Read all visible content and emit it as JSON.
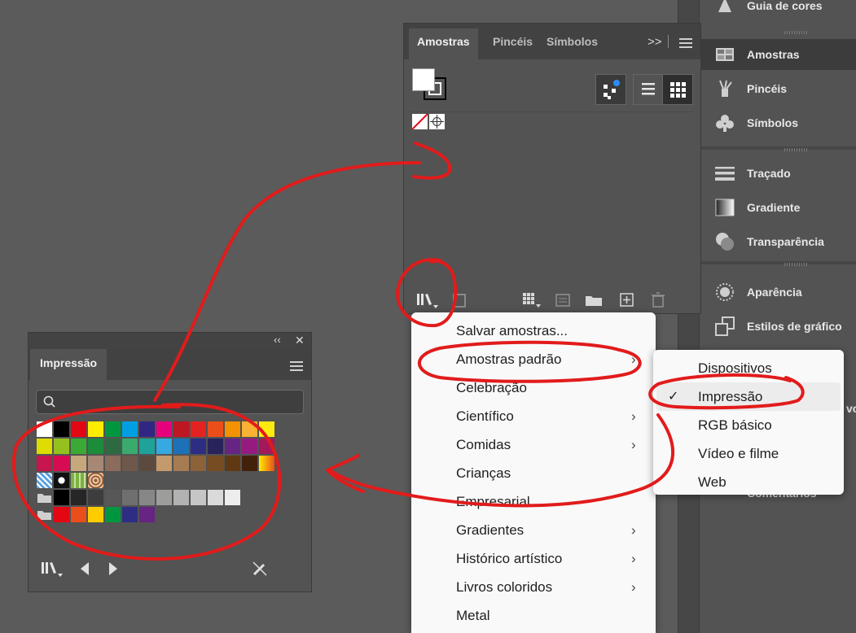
{
  "dock": {
    "top_partial": "Guia de cores",
    "items": [
      {
        "label": "Amostras",
        "icon": "swatches-icon",
        "active": true
      },
      {
        "label": "Pincéis",
        "icon": "brushes-icon"
      },
      {
        "label": "Símbolos",
        "icon": "symbols-icon"
      },
      {
        "label": "Traçado",
        "icon": "stroke-icon"
      },
      {
        "label": "Gradiente",
        "icon": "gradient-icon"
      },
      {
        "label": "Transparência",
        "icon": "transparency-icon"
      },
      {
        "label": "Aparência",
        "icon": "appearance-icon"
      },
      {
        "label": "Estilos de gráfico",
        "icon": "graphic-styles-icon"
      }
    ],
    "partial_hidden_1": "vo",
    "partial_hidden_2": "Comentários"
  },
  "swatches_panel": {
    "tabs": [
      "Amostras",
      "Pincéis",
      "Símbolos"
    ],
    "overflow_label": ">>",
    "fill_color": "#ffffff",
    "stroke_color": "#000000"
  },
  "menu": {
    "items": [
      {
        "label": "Salvar amostras...",
        "submenu": false
      },
      {
        "label": "Amostras padrão",
        "submenu": true
      },
      {
        "label": "Celebração",
        "submenu": false
      },
      {
        "label": "Científico",
        "submenu": true
      },
      {
        "label": "Comidas",
        "submenu": true
      },
      {
        "label": "Crianças",
        "submenu": false
      },
      {
        "label": "Empresarial",
        "submenu": false
      },
      {
        "label": "Gradientes",
        "submenu": true
      },
      {
        "label": "Histórico artístico",
        "submenu": true
      },
      {
        "label": "Livros coloridos",
        "submenu": true
      },
      {
        "label": "Metal",
        "submenu": false
      }
    ]
  },
  "submenu": {
    "items": [
      {
        "label": "Dispositivos",
        "checked": false
      },
      {
        "label": "Impressão",
        "checked": true
      },
      {
        "label": "RGB básico",
        "checked": false
      },
      {
        "label": "Vídeo e filme",
        "checked": false
      },
      {
        "label": "Web",
        "checked": false
      }
    ]
  },
  "library_panel": {
    "title": "Impressão",
    "collapse_label": "‹‹",
    "close_label": "✕",
    "search_placeholder": "",
    "rows": [
      [
        "#ffffff",
        "#000000",
        "#e30613",
        "#ffed00",
        "#009640",
        "#009fe3",
        "#312783",
        "#e6007e",
        "#be1622",
        "#e42320",
        "#e94e1b",
        "#f39200",
        "#f9b233",
        "#fcea10"
      ],
      [
        "#dedc00",
        "#95c11f",
        "#3aaa35",
        "#1d8c3a",
        "#2d6a3f",
        "#3aaa6d",
        "#1fa29a",
        "#36a9e1",
        "#1d71b8",
        "#2d2e83",
        "#29235c",
        "#662483",
        "#951b81",
        "#a3195b"
      ],
      [
        "#c6154f",
        "#d60b52",
        "#c7a77c",
        "#a68875",
        "#8b6c5c",
        "#6f574b",
        "#5c4a3f",
        "#c49a6c",
        "#a67c52",
        "#8c6239",
        "#754c24",
        "#603913",
        "#42210b",
        "#gradient"
      ],
      [
        "#pattern1",
        "#pattern2",
        "#pattern3",
        "#pattern4"
      ],
      [
        "#folder",
        "#000000",
        "#262626",
        "#3d3d3d",
        "#575756",
        "#706f6f",
        "#878787",
        "#9d9d9c",
        "#b2b2b2",
        "#c6c6c6",
        "#dadada",
        "#ededed"
      ],
      [
        "#folder",
        "#e30613",
        "#e94e1b",
        "#ffcc00",
        "#009640",
        "#2d2e83",
        "#662483"
      ]
    ]
  },
  "colors": {
    "annotation": "#e21b1b",
    "menu_bg": "#f9f9f9",
    "panel_bg": "#535353"
  }
}
